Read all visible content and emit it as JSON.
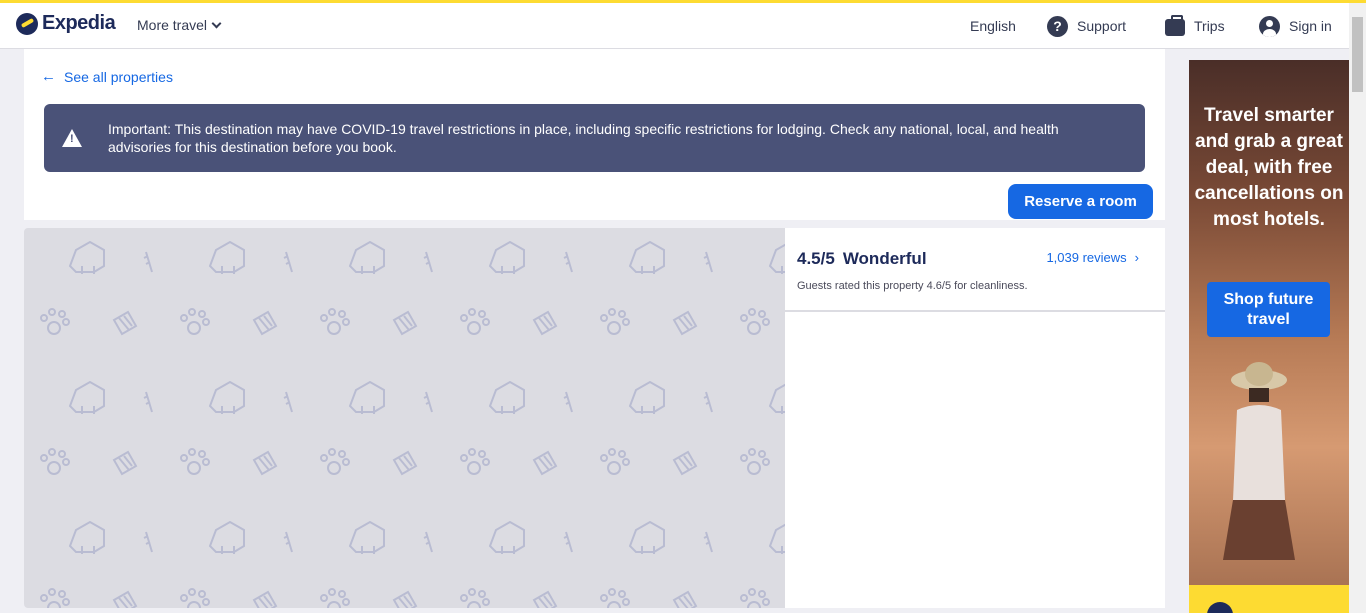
{
  "header": {
    "brand": "Expedia",
    "more_travel": "More travel",
    "language": "English",
    "support": "Support",
    "trips": "Trips",
    "sign_in": "Sign in"
  },
  "property": {
    "back_link": "See all properties",
    "alert_text": "Important: This destination may have COVID-19 travel restrictions in place, including specific restrictions for lodging. Check any national, local, and health advisories for this destination before you book.",
    "reserve_button": "Reserve a room"
  },
  "reviews": {
    "score": "4.5/5",
    "label": "Wonderful",
    "count_link": "1,039 reviews",
    "cleanliness": "Guests rated this property 4.6/5 for cleanliness."
  },
  "ad": {
    "headline": "Travel smarter and grab a great deal, with free cancellations on most hotels.",
    "button": "Shop future travel"
  },
  "colors": {
    "brand_blue": "#1668e3",
    "brand_navy": "#1d2a5a",
    "brand_yellow": "#fddb32",
    "alert_bg": "#4a5278"
  }
}
